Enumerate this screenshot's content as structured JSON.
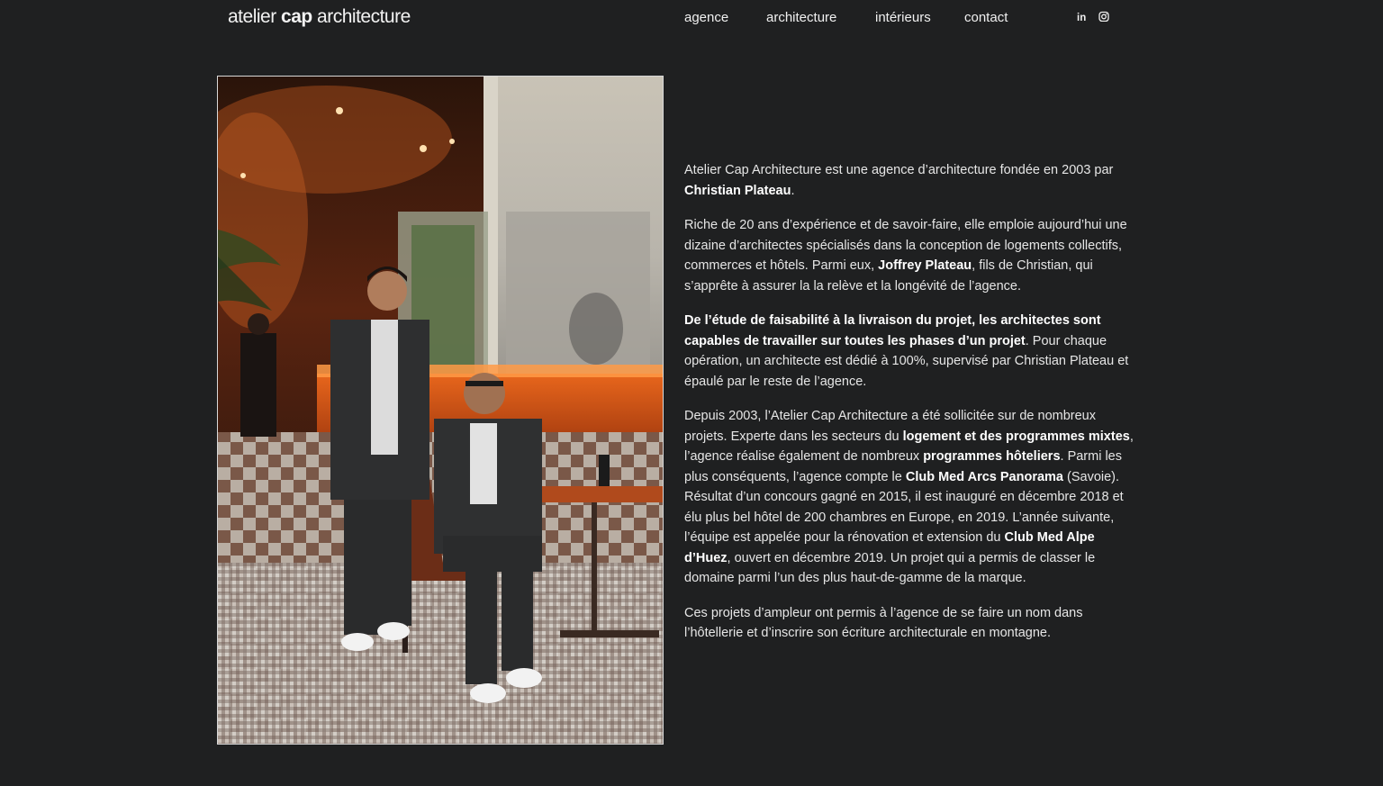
{
  "header": {
    "logo": {
      "part1": "atelier ",
      "part2": "cap",
      "part3": " architecture"
    },
    "nav": [
      {
        "label": "agence"
      },
      {
        "label": "architecture"
      },
      {
        "label": "intérieurs"
      },
      {
        "label": "contact"
      }
    ],
    "social": [
      {
        "icon": "linkedin-icon",
        "text": "in"
      },
      {
        "icon": "instagram-icon"
      }
    ]
  },
  "photo": {
    "icon": "team-photo"
  },
  "content": {
    "p1": {
      "t1": "Atelier Cap Architecture est une agence d’architecture fondée en 2003 par ",
      "b1": "Christian Plateau",
      "t2": "."
    },
    "p2": {
      "t1": "Riche de 20 ans d’expérience et de savoir-faire, elle emploie aujourd’hui une dizaine d’architectes spécialisés dans la conception de logements collectifs, commerces et hôtels. Parmi eux, ",
      "b1": "Joffrey Plateau",
      "t2": ", fils de Christian, qui s’apprête à assurer la la relève et la longévité de l’agence."
    },
    "p3": {
      "b1": "De l’étude de faisabilité à la livraison du projet, les architectes sont capables de travailler sur toutes les phases d’un projet",
      "t1": ". Pour chaque opération, un architecte est dédié à 100%, supervisé par Christian Plateau et épaulé par le reste de l’agence."
    },
    "p4": {
      "t1": "Depuis 2003, l’Atelier Cap Architecture a été sollicitée sur de nombreux projets. Experte dans les secteurs du ",
      "b1": "logement et des programmes mixtes",
      "t2": ", l’agence réalise également de nombreux ",
      "b2": "programmes hôteliers",
      "t3": ". Parmi les plus conséquents, l’agence compte le ",
      "b3": "Club Med Arcs Panorama",
      "t4": " (Savoie). Résultat d’un concours gagné en 2015, il est inauguré en décembre 2018 et élu plus bel hôtel de 200 chambres en Europe, en 2019. L’année suivante, l’équipe est appelée pour la rénovation et extension du ",
      "b4": "Club Med Alpe d’Huez",
      "t5": ", ouvert en décembre 2019. Un projet qui a permis de classer le domaine parmi l’un des plus haut-de-gamme de la marque."
    },
    "p5": {
      "t1": "Ces projets d’ampleur ont permis à l’agence de se faire un nom dans l’hôtellerie et d’inscrire son écriture architecturale en montagne."
    }
  }
}
